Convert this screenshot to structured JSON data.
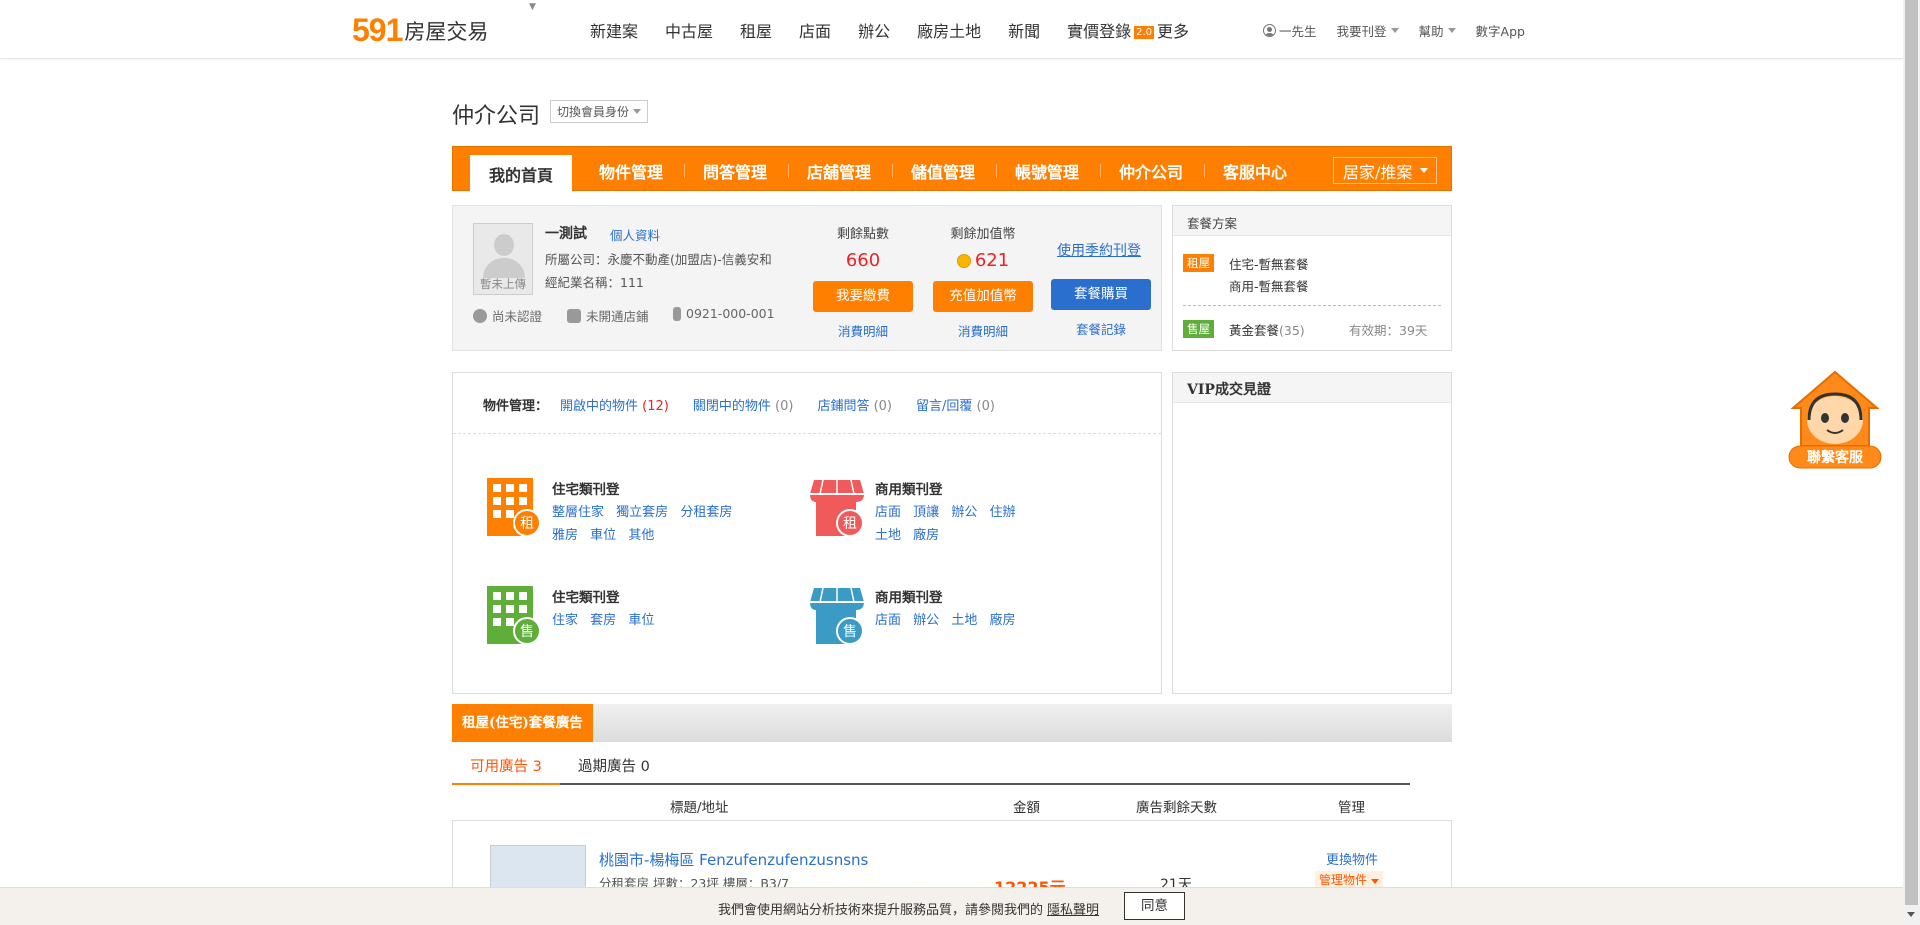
{
  "logo": {
    "num": "591",
    "text": "房屋交易"
  },
  "mainnav": [
    "新建案",
    "中古屋",
    "租屋",
    "店面",
    "辦公",
    "廠房土地",
    "新聞",
    "實價登錄",
    "更多"
  ],
  "mainnav_badge": "2.0",
  "usernav": {
    "user": "一先生",
    "post": "我要刊登",
    "help": "幫助",
    "app": "數字App"
  },
  "page_title": "仲介公司",
  "switch_role": "切換會員身份",
  "tabs": [
    "我的首頁",
    "物件管理",
    "問答管理",
    "店舖管理",
    "儲值管理",
    "帳號管理",
    "仲介公司",
    "客服中心"
  ],
  "tab_select": "居家/推案",
  "profile": {
    "avatar_label": "暫未上傳",
    "name": "一測試",
    "profile_link": "個人資料",
    "company": "所屬公司：永慶不動產(加盟店)-信義安和",
    "agent_id": "經紀業名稱：111",
    "status_cert": "尚未認證",
    "status_store": "未開通店鋪",
    "phone": "0921-000-001"
  },
  "stats": [
    {
      "label": "剩餘點數",
      "value": "660",
      "button": "我要繳費",
      "sub": "消費明細",
      "btn_color": "orange"
    },
    {
      "label": "剩餘加值幣",
      "value": "621",
      "button": "充值加值幣",
      "sub": "消費明細",
      "btn_color": "orange"
    },
    {
      "label": "",
      "value": "",
      "button": "套餐購買",
      "sub": "套餐記錄",
      "btn_color": "blue"
    }
  ],
  "use_contract": "使用季約刊登",
  "package": {
    "title": "套餐方案",
    "rent_tag": "租屋",
    "rent_res": "住宅-暫無套餐",
    "rent_com": "商用-暫無套餐",
    "sale_tag": "售屋",
    "sale_name": "黃金套餐",
    "sale_count": "(35)",
    "sale_valid": "有效期：39天"
  },
  "propmgmt": {
    "label": "物件管理：",
    "links": [
      {
        "text": "開啟中的物件",
        "count": "(12)",
        "red": true
      },
      {
        "text": "關閉中的物件",
        "count": "(0)",
        "red": false
      },
      {
        "text": "店鋪問答",
        "count": "(0)",
        "red": false
      },
      {
        "text": "留言/回覆",
        "count": "(0)",
        "red": false
      }
    ]
  },
  "categories": [
    {
      "title": "住宅類刊登",
      "badge": "租",
      "links": [
        "整層住家",
        "獨立套房",
        "分租套房",
        "雅房",
        "車位",
        "其他"
      ]
    },
    {
      "title": "商用類刊登",
      "badge": "租",
      "links": [
        "店面",
        "頂讓",
        "辦公",
        "住辦",
        "土地",
        "廠房"
      ]
    },
    {
      "title": "住宅類刊登",
      "badge": "售",
      "links": [
        "住家",
        "套房",
        "車位"
      ]
    },
    {
      "title": "商用類刊登",
      "badge": "售",
      "links": [
        "店面",
        "辦公",
        "土地",
        "廠房"
      ]
    }
  ],
  "vip_title": "VIP成交見證",
  "ads": {
    "bar_title": "租屋(住宅)套餐廣告",
    "tab_avail": "可用廣告 3",
    "tab_expired": "過期廣告 0",
    "headers": [
      "標題/地址",
      "金額",
      "廣告剩餘天數",
      "管理"
    ],
    "row": {
      "title": "桃園市-楊梅區  Fenzufenzufenzusnsns",
      "sub": "分租套房  坪數：23坪  樓層：B3/7",
      "price": "12225元",
      "days": "21天",
      "action1": "更換物件",
      "action2": "管理物件"
    }
  },
  "cookie": {
    "text": "我們會使用網站分析技術來提升服務品質，請參閱我們的",
    "link": "隱私聲明",
    "button": "同意"
  },
  "support_label": "聯繫客服",
  "colors": {
    "brand": "#ff8000",
    "link": "#2a6fce",
    "price": "#e22222",
    "sale": "#5fae3a"
  }
}
